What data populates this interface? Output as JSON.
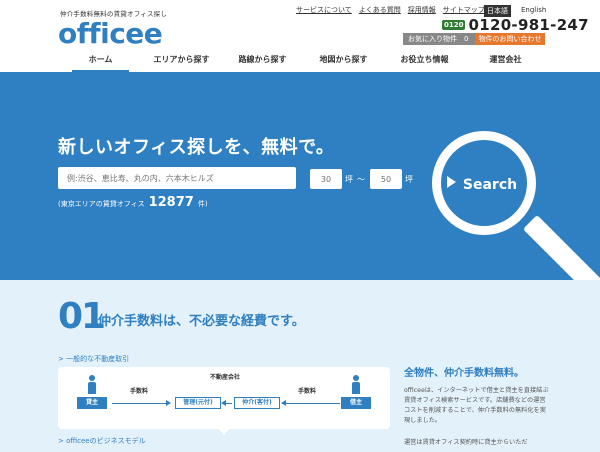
{
  "header": {
    "tagline": "仲介手数料無料の賃貸オフィス探し",
    "logo": "officee",
    "top_links": [
      "サービスについて",
      "よくある質問",
      "採用情報",
      "サイトマップ"
    ],
    "lang_ja": "日本語",
    "lang_en": "English",
    "free_dial": "0120",
    "phone": "0120-981-247",
    "favorites_label": "お気に入り物件　0　件",
    "inquiry_label": "物件のお問い合わせ",
    "nav": [
      "ホーム",
      "エリアから探す",
      "路線から探す",
      "地図から探す",
      "お役立ち情報",
      "運営会社"
    ]
  },
  "hero": {
    "title": "新しいオフィス探しを、無料で。",
    "keyword_placeholder": "例:渋谷、恵比寿、丸の内、六本木ヒルズ",
    "min_value": "30",
    "max_value": "50",
    "unit": "坪",
    "tilde": "〜",
    "count_label": "(東京エリアの賃貸オフィス",
    "count": "12877",
    "count_suffix": "件)",
    "search_label": "Search"
  },
  "section": {
    "number": "01",
    "title": "仲介手数料は、不必要な経費です。",
    "sub1": "> 一般的な不動産取引",
    "sub2": "> officeeのビジネスモデル",
    "flow": {
      "agent_title": "不動産会社",
      "left_party": "貸主",
      "right_party": "借主",
      "left_fee": "手数料",
      "right_fee": "手数料",
      "mgmt": "管理(元付)",
      "broker": "仲介(客付)"
    },
    "right_title": "全物件、仲介手数料無料。",
    "right_text": "officeeは、インターネットで借主と貸主を直接結ぶ賃貸オフィス検索サービスです。店舗費などの運営コストを削減することで、仲介手数料の無料化を実現しました。",
    "right_text2": "運営は賃貸オフィス契約時に貸主からいただ"
  },
  "colors": {
    "brand_blue": "#2f7fc1",
    "hero_blue": "#2e80c3",
    "section_bg": "#e3f1fb",
    "inquiry_orange": "#e8772e"
  }
}
